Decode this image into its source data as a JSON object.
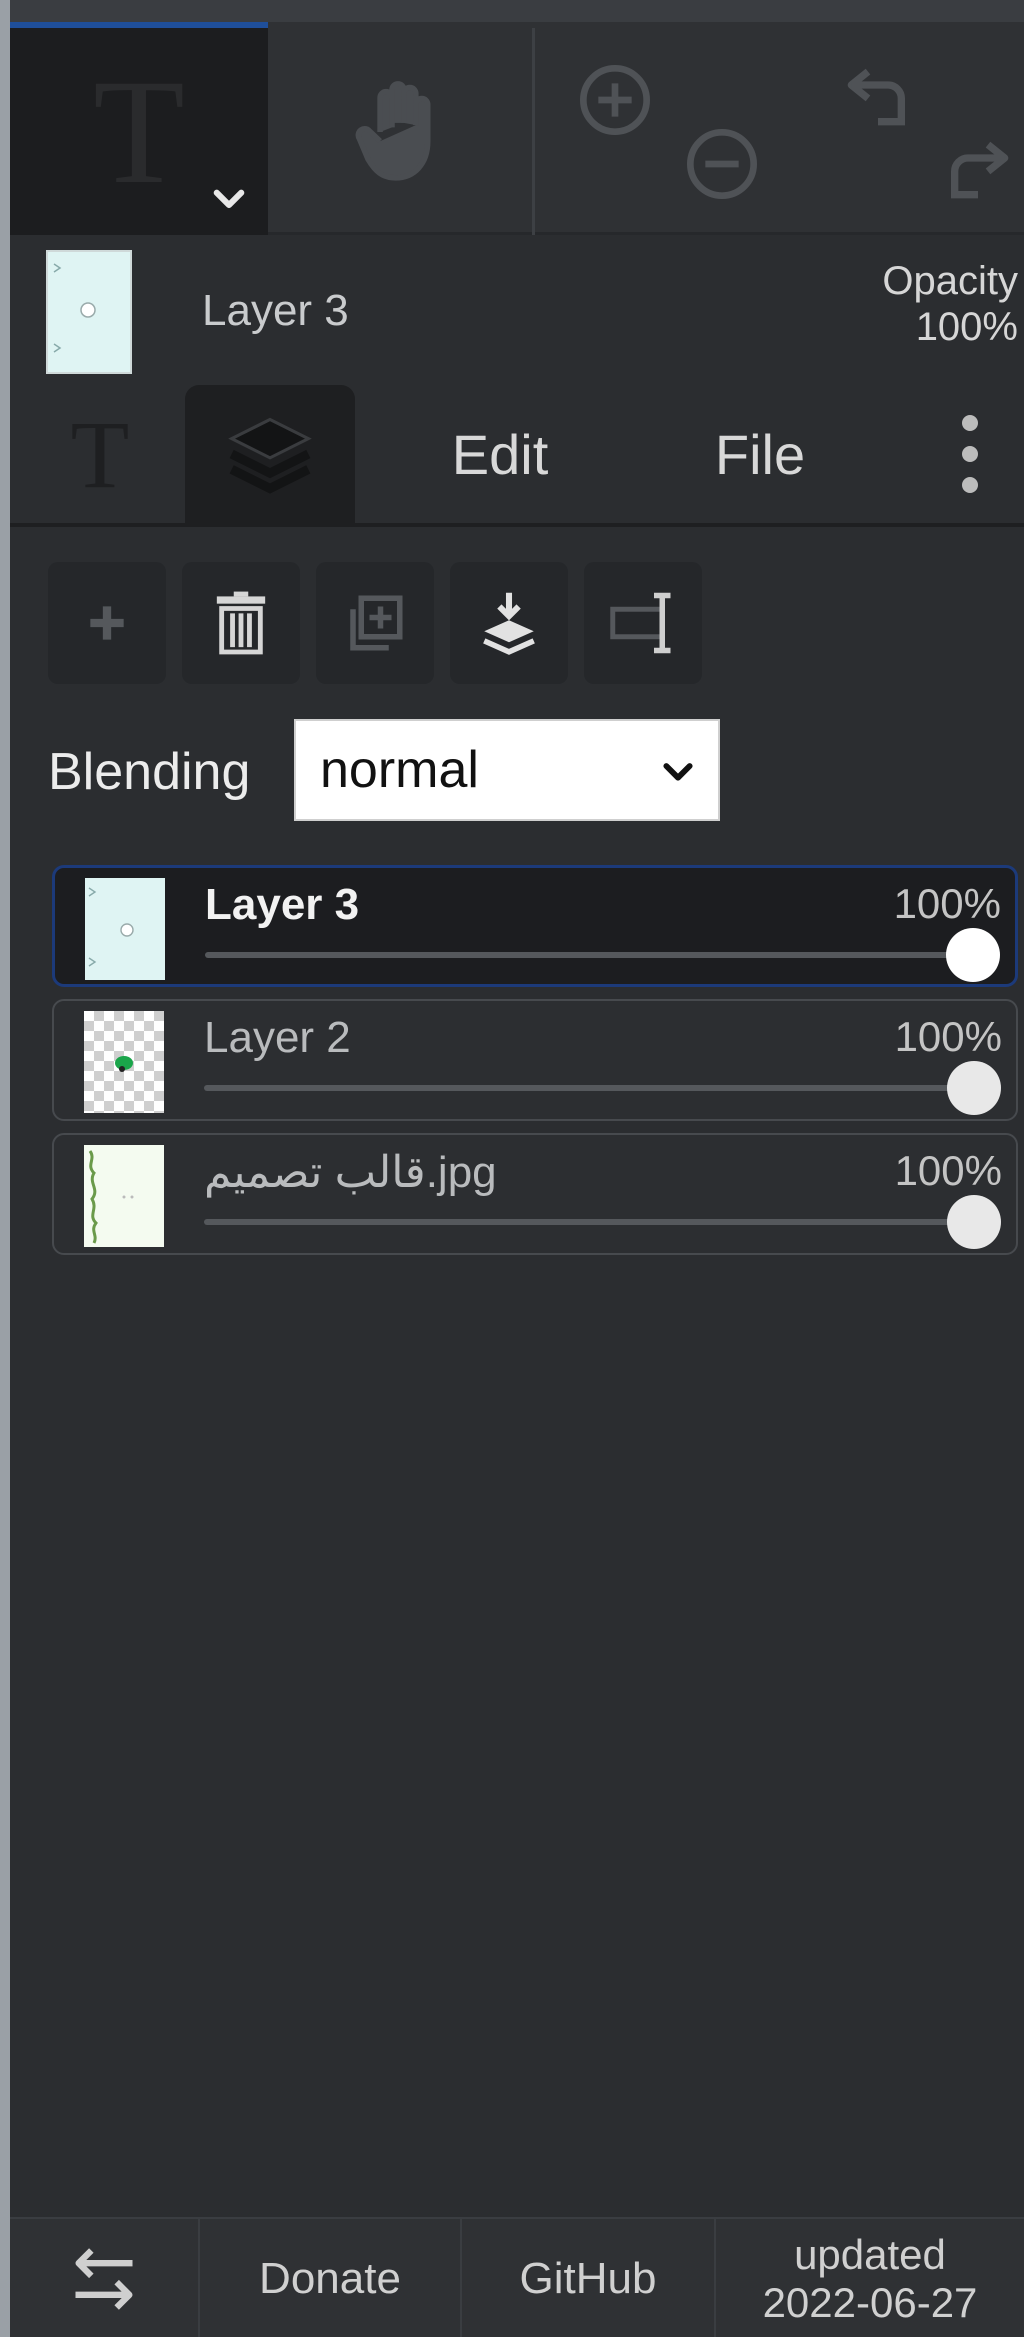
{
  "toolbar": {
    "text_tool_glyph": "T",
    "tools": [
      "text-tool",
      "hand-tool",
      "zoom-in",
      "zoom-out",
      "undo",
      "redo"
    ]
  },
  "current_layer": {
    "name": "Layer 3",
    "opacity_label": "Opacity",
    "opacity_value": "100%"
  },
  "tabs": {
    "text_glyph": "T",
    "edit": "Edit",
    "file": "File"
  },
  "blending": {
    "label": "Blending",
    "value": "normal"
  },
  "layers": [
    {
      "name": "Layer 3",
      "opacity": "100%",
      "value": 1.0,
      "selected": true
    },
    {
      "name": "Layer 2",
      "opacity": "100%",
      "value": 1.0,
      "selected": false
    },
    {
      "name": "قالب تصميم.jpg",
      "opacity": "100%",
      "value": 1.0,
      "selected": false
    }
  ],
  "footer": {
    "donate": "Donate",
    "github": "GitHub",
    "updated_label": "updated",
    "updated_date": "2022-06-27"
  },
  "colors": {
    "panel_bg": "#2b2d30",
    "selected_border": "#1c3a7a",
    "accent": "#1f4f9a"
  }
}
